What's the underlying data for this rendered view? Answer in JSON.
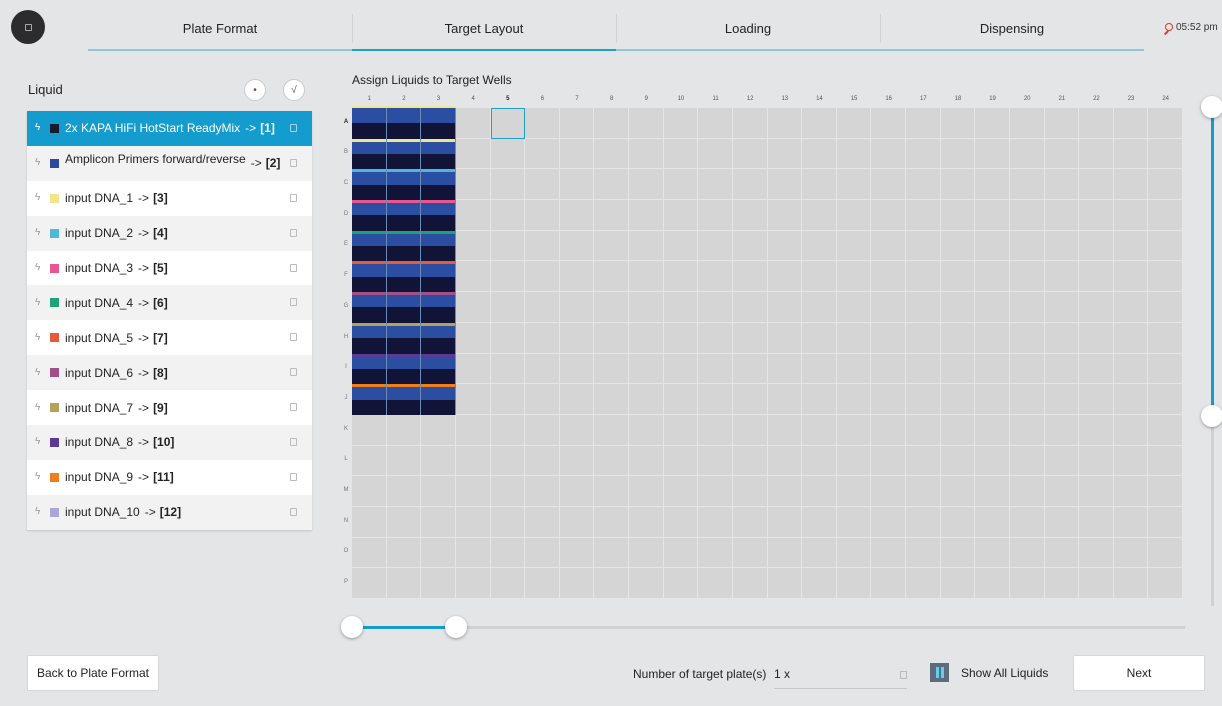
{
  "nav": {
    "steps": [
      "Plate Format",
      "Target Layout",
      "Loading",
      "Dispensing"
    ],
    "active_step": "Target Layout",
    "time": "05:52 pm"
  },
  "liquid_panel": {
    "title": "Liquid",
    "items": [
      {
        "name": "2x KAPA HiFi HotStart ReadyMix",
        "arrow": "->",
        "num": "[1]",
        "color": "#1a1a2e",
        "selected": true
      },
      {
        "name": "Amplicon Primers forward/reverse",
        "arrow": "->",
        "num": "[2]",
        "color": "#2a4aa0"
      },
      {
        "name": "input DNA_1",
        "arrow": "->",
        "num": "[3]",
        "color": "#f0e68c"
      },
      {
        "name": "input DNA_2",
        "arrow": "->",
        "num": "[4]",
        "color": "#4fb8d8"
      },
      {
        "name": "input DNA_3",
        "arrow": "->",
        "num": "[5]",
        "color": "#e8578f"
      },
      {
        "name": "input DNA_4",
        "arrow": "->",
        "num": "[6]",
        "color": "#1fa27a"
      },
      {
        "name": "input DNA_5",
        "arrow": "->",
        "num": "[7]",
        "color": "#e85a3a"
      },
      {
        "name": "input DNA_6",
        "arrow": "->",
        "num": "[8]",
        "color": "#a3508a"
      },
      {
        "name": "input DNA_7",
        "arrow": "->",
        "num": "[9]",
        "color": "#b2a25a"
      },
      {
        "name": "input DNA_8",
        "arrow": "->",
        "num": "[10]",
        "color": "#5a3a94"
      },
      {
        "name": "input DNA_9",
        "arrow": "->",
        "num": "[11]",
        "color": "#f07f1a"
      },
      {
        "name": "input DNA_10",
        "arrow": "->",
        "num": "[12]",
        "color": "#a7a7d8"
      }
    ]
  },
  "plate": {
    "title": "Assign Liquids to Target Wells",
    "columns": [
      "1",
      "2",
      "3",
      "4",
      "5",
      "6",
      "7",
      "8",
      "9",
      "10",
      "11",
      "12",
      "13",
      "14",
      "15",
      "16",
      "17",
      "18",
      "19",
      "20",
      "21",
      "22",
      "23",
      "24"
    ],
    "rows": [
      "A",
      "B",
      "C",
      "D",
      "E",
      "F",
      "G",
      "H",
      "I",
      "J",
      "K",
      "L",
      "M",
      "N",
      "O",
      "P"
    ],
    "highlight_column": "5",
    "highlight_row": "A",
    "filled_rows": 10,
    "filled_columns": 3,
    "row_stripe_colors": [
      "#f0e68c",
      "#4fb8d8",
      "#e8578f",
      "#1fa27a",
      "#e85a3a",
      "#a3508a",
      "#b2a25a",
      "#5a3a94",
      "#f07f1a",
      "#a7a7d8"
    ],
    "selected_well": "A5"
  },
  "footer": {
    "back_label": "Back to Plate Format",
    "plates_label": "Number of target plate(s)",
    "plates_value": "1 x",
    "show_all_label": "Show All Liquids",
    "next_label": "Next"
  }
}
